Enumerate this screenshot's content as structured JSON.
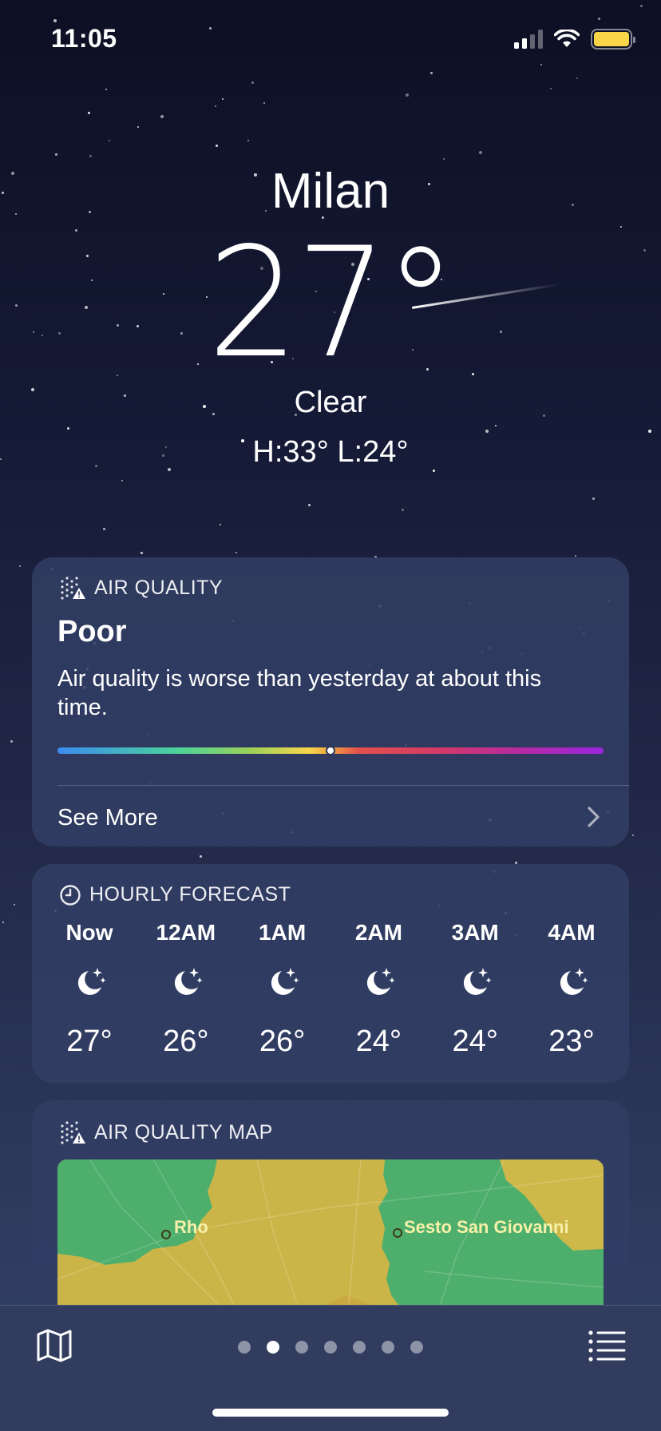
{
  "status_bar": {
    "time": "11:05",
    "battery_color": "#f8d648"
  },
  "hero": {
    "city": "Milan",
    "temperature": "27°",
    "condition": "Clear",
    "high_low": "H:33°  L:24°"
  },
  "air_quality": {
    "header": "AIR QUALITY",
    "icon": "air-quality-icon",
    "level": "Poor",
    "description": "Air quality is worse than yesterday at about this time.",
    "index_fraction": 0.5,
    "see_more": "See More"
  },
  "hourly": {
    "header": "HOURLY FORECAST",
    "icon": "clock-icon",
    "items": [
      {
        "label": "Now",
        "icon": "moon-stars-icon",
        "temp": "27°"
      },
      {
        "label": "12AM",
        "icon": "moon-stars-icon",
        "temp": "26°"
      },
      {
        "label": "1AM",
        "icon": "moon-stars-icon",
        "temp": "26°"
      },
      {
        "label": "2AM",
        "icon": "moon-stars-icon",
        "temp": "24°"
      },
      {
        "label": "3AM",
        "icon": "moon-stars-icon",
        "temp": "24°"
      },
      {
        "label": "4AM",
        "icon": "moon-stars-icon",
        "temp": "23°"
      }
    ]
  },
  "air_quality_map": {
    "header": "AIR QUALITY MAP",
    "labels": [
      "Rho",
      "Sesto San Giovanni"
    ],
    "colors": {
      "good": "#4db470",
      "moderate": "#d4bc4a"
    }
  },
  "bottom_bar": {
    "page_count": 7,
    "active_page": 1
  }
}
